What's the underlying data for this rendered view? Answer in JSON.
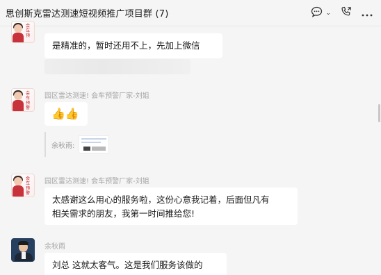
{
  "header": {
    "title": "思创斯克雷达测速短视频推广项目群 (7)"
  },
  "messages": [
    {
      "sender": "",
      "text": "是精准的，暂时还用不上，先加上微信"
    },
    {
      "sender": "园区雷达测速! 会车预警厂家-刘姐",
      "text": "👍👍",
      "quote_name": "余秋雨:"
    },
    {
      "sender": "园区雷达测速! 会车预警厂家-刘姐",
      "line1": "太感谢这么用心的服务啦，这份心意我记着，后面但凡有",
      "line2": "相关需求的朋友，我第一时间推给您!"
    },
    {
      "sender": "余秋雨",
      "text": "刘总 这就太客气。这是我们服务该做的"
    }
  ],
  "avatar_stamp": [
    "会",
    "车",
    "预",
    "警"
  ],
  "colors": {
    "background": "#f5f5f5",
    "bubble": "#ffffff",
    "sender_name": "#a6a6a6",
    "stamp_red": "#c1272d"
  },
  "icons": {
    "chat": "chat-bubble-icon",
    "dropdown": "chevron-down-icon",
    "call": "phone-icon",
    "more": "more-icon"
  }
}
